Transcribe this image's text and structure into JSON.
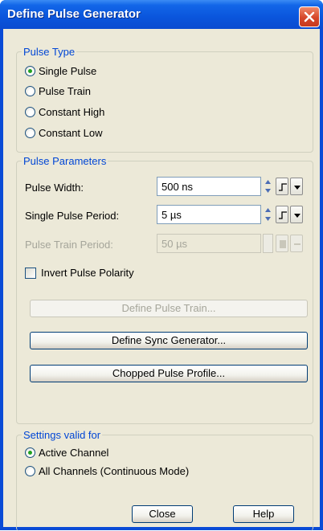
{
  "window": {
    "title": "Define Pulse Generator"
  },
  "pulse_type": {
    "title": "Pulse Type",
    "options": [
      {
        "label": "Single Pulse",
        "checked": true
      },
      {
        "label": "Pulse Train",
        "checked": false
      },
      {
        "label": "Constant High",
        "checked": false
      },
      {
        "label": "Constant Low",
        "checked": false
      }
    ]
  },
  "pulse_params": {
    "title": "Pulse Parameters",
    "width": {
      "label": "Pulse Width:",
      "value": "500 ns"
    },
    "single_period": {
      "label": "Single Pulse Period:",
      "value": "5 µs"
    },
    "train_period": {
      "label": "Pulse Train Period:",
      "value": "50 µs"
    },
    "invert": {
      "label": "Invert Pulse Polarity",
      "checked": false
    },
    "define_train": "Define Pulse Train...",
    "define_sync": "Define Sync Generator...",
    "chopped": "Chopped Pulse Profile..."
  },
  "settings": {
    "title": "Settings valid for",
    "options": [
      {
        "label": "Active Channel",
        "checked": true
      },
      {
        "label": "All Channels (Continuous Mode)",
        "checked": false
      }
    ]
  },
  "footer": {
    "close": "Close",
    "help": "Help"
  },
  "icons": [
    "close-icon",
    "spinner-icon",
    "pulse-edge-icon",
    "dropdown-arrow-icon"
  ],
  "colors": {
    "title_bar": "#0a55dc",
    "group_title": "#0046d5",
    "face": "#ece9d8"
  }
}
